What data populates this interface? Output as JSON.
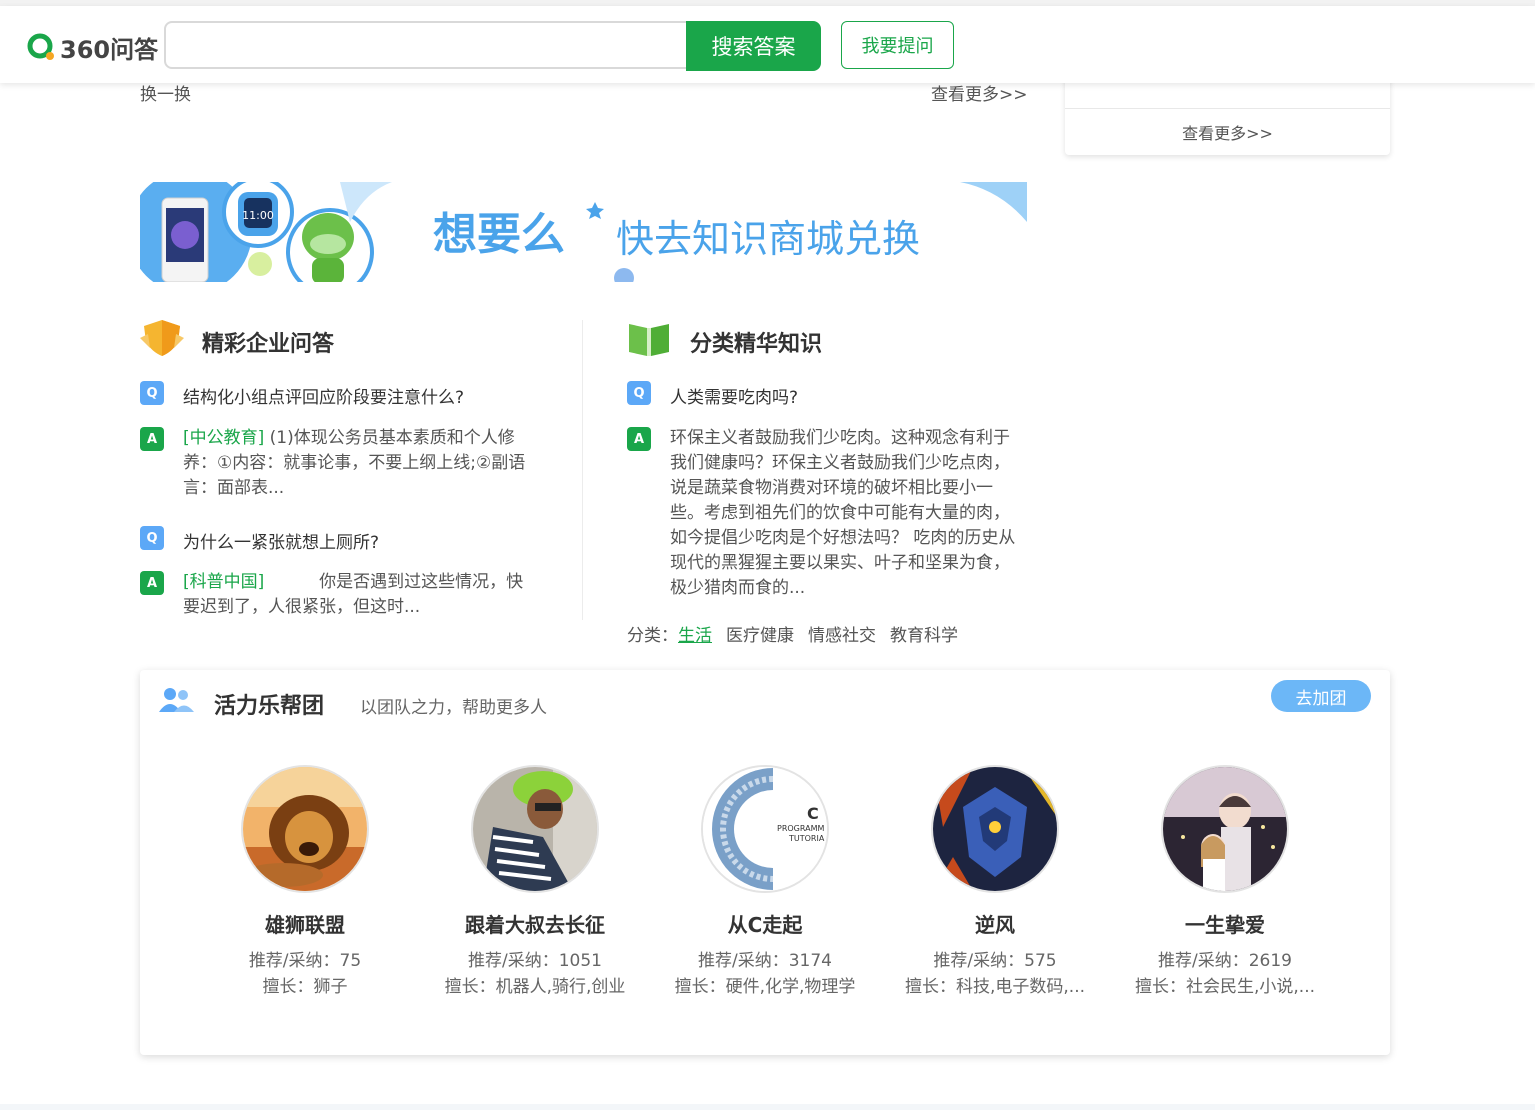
{
  "header": {
    "logo_text": "360问答",
    "search_placeholder": "",
    "search_button": "搜索答案",
    "ask_button": "我要提问"
  },
  "top_links": {
    "refresh": "换一换",
    "more": "查看更多>>"
  },
  "right_card": {
    "more": "查看更多>>"
  },
  "banner": {
    "slogan": "想要么",
    "text": "快去知识商城兑换"
  },
  "enterprise": {
    "title": "精彩企业问答",
    "items": [
      {
        "question": "结构化小组点评回应阶段要注意什么?",
        "source": "[中公教育]",
        "answer_line1": "(1)体现公务员基本素质和个人修",
        "answer_line2": "养：①内容：就事论事，不要上纲上线;②副语",
        "answer_line3": "言：面部表..."
      },
      {
        "question": "为什么一紧张就想上厕所?",
        "source": "[科普中国]",
        "answer_line1": "你是否遇到过这些情况，快",
        "answer_line2": "要迟到了，人很紧张，但这时..."
      }
    ]
  },
  "category": {
    "title": "分类精华知识",
    "question": "人类需要吃肉吗?",
    "answer_lines": [
      "环保主义者鼓励我们少吃肉。这种观念有利于",
      "我们健康吗？环保主义者鼓励我们少吃点肉，",
      "说是蔬菜食物消费对环境的破坏相比要小一",
      "些。考虑到祖先们的饮食中可能有大量的肉，",
      "如今提倡少吃肉是个好想法吗？ 吃肉的历史从",
      "现代的黑猩猩主要以果实、叶子和坚果为食，",
      "极少猎肉而食的..."
    ],
    "cat_label": "分类：",
    "cats": [
      "生活",
      "医疗健康",
      "情感社交",
      "教育科学"
    ]
  },
  "team": {
    "title": "活力乐帮团",
    "subtitle": "以团队之力，帮助更多人",
    "join": "去加团",
    "members": [
      {
        "name": "雄狮联盟",
        "stat": "推荐/采纳：75",
        "skill": "擅长：狮子"
      },
      {
        "name": "跟着大叔去长征",
        "stat": "推荐/采纳：1051",
        "skill": "擅长：机器人,骑行,创业"
      },
      {
        "name": "从C走起",
        "stat": "推荐/采纳：3174",
        "skill": "擅长：硬件,化学,物理学"
      },
      {
        "name": "逆风",
        "stat": "推荐/采纳：575",
        "skill": "擅长：科技,电子数码,..."
      },
      {
        "name": "一生挚爱",
        "stat": "推荐/采纳：2619",
        "skill": "擅长：社会民生,小说,..."
      }
    ]
  },
  "colors": {
    "brand_green": "#1aa64a",
    "question_blue": "#5ca8f7",
    "join_blue": "#6cb7f7"
  }
}
